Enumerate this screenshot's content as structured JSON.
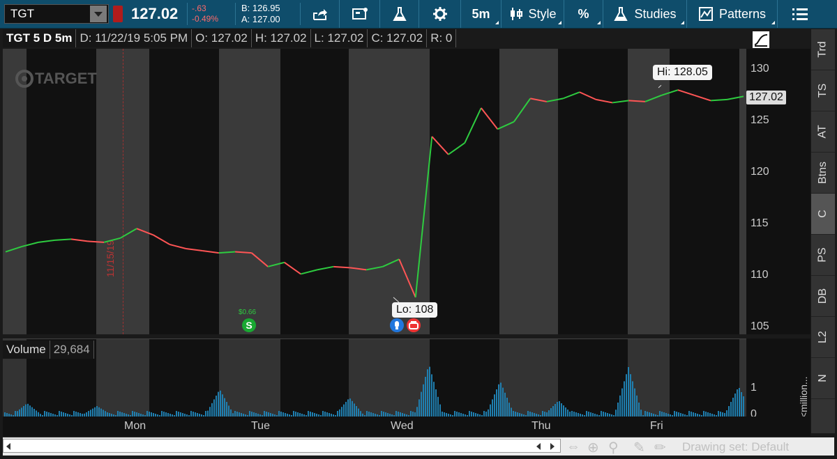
{
  "toolbar": {
    "symbol": "TGT",
    "last_price": "127.02",
    "change": "-.63",
    "change_pct": "-0.49%",
    "bid": "B: 126.95",
    "ask": "A: 127.00",
    "timeframe": "5m",
    "style_label": "Style",
    "studies_label": "Studies",
    "patterns_label": "Patterns",
    "icons": [
      "share-icon",
      "message-icon",
      "flask-icon",
      "gear-icon",
      "candlestick-icon",
      "percent-icon",
      "flask-icon",
      "patterns-icon",
      "menu-icon"
    ]
  },
  "chart_header": {
    "title": "TGT 5 D 5m",
    "date": "D: 11/22/19 5:05 PM",
    "open": "O: 127.02",
    "high": "H: 127.02",
    "low": "L: 127.02",
    "close": "C: 127.02",
    "range": "R: 0"
  },
  "watermark": "TARGET",
  "price_axis": [
    "130",
    "125",
    "120",
    "115",
    "110",
    "105"
  ],
  "last_price_label": "127.02",
  "hi_callout": "Hi: 128.05",
  "lo_callout": "Lo: 108",
  "date_marker": "11/15/19",
  "dividend_label": "$0.66",
  "volume": {
    "label": "Volume",
    "value": "29,684",
    "axis": [
      "1",
      "0"
    ],
    "unit": "<million..."
  },
  "x_axis": [
    "Mon",
    "Tue",
    "Wed",
    "Thu",
    "Fri"
  ],
  "side_tabs": [
    "Trd",
    "TS",
    "AT",
    "Btns",
    "C",
    "PS",
    "DB",
    "L2",
    "N"
  ],
  "active_tab": "C",
  "drawing_set": "Drawing set: Default",
  "chart_data": {
    "type": "line",
    "series": [
      {
        "values": [
          112.3,
          112.8,
          113.2,
          113.4,
          113.5,
          113.3,
          113.2,
          113.6,
          114.5,
          113.9,
          113.0,
          112.6,
          112.4,
          112.2,
          112.3,
          112.2,
          110.9,
          111.3,
          110.2,
          110.6,
          110.9,
          110.8,
          110.6,
          110.9,
          111.6,
          108.0,
          123.2,
          121.5,
          122.6,
          125.9,
          123.9,
          124.6,
          126.8,
          126.5,
          126.8,
          127.4,
          126.7,
          126.4,
          126.6,
          126.5,
          127.1,
          127.6,
          127.1,
          126.6,
          126.7,
          127.0
        ]
      }
    ],
    "ylim": [
      104.5,
      131.5
    ],
    "grid": false,
    "extremes": {
      "high": 128.05,
      "low": 108
    }
  }
}
